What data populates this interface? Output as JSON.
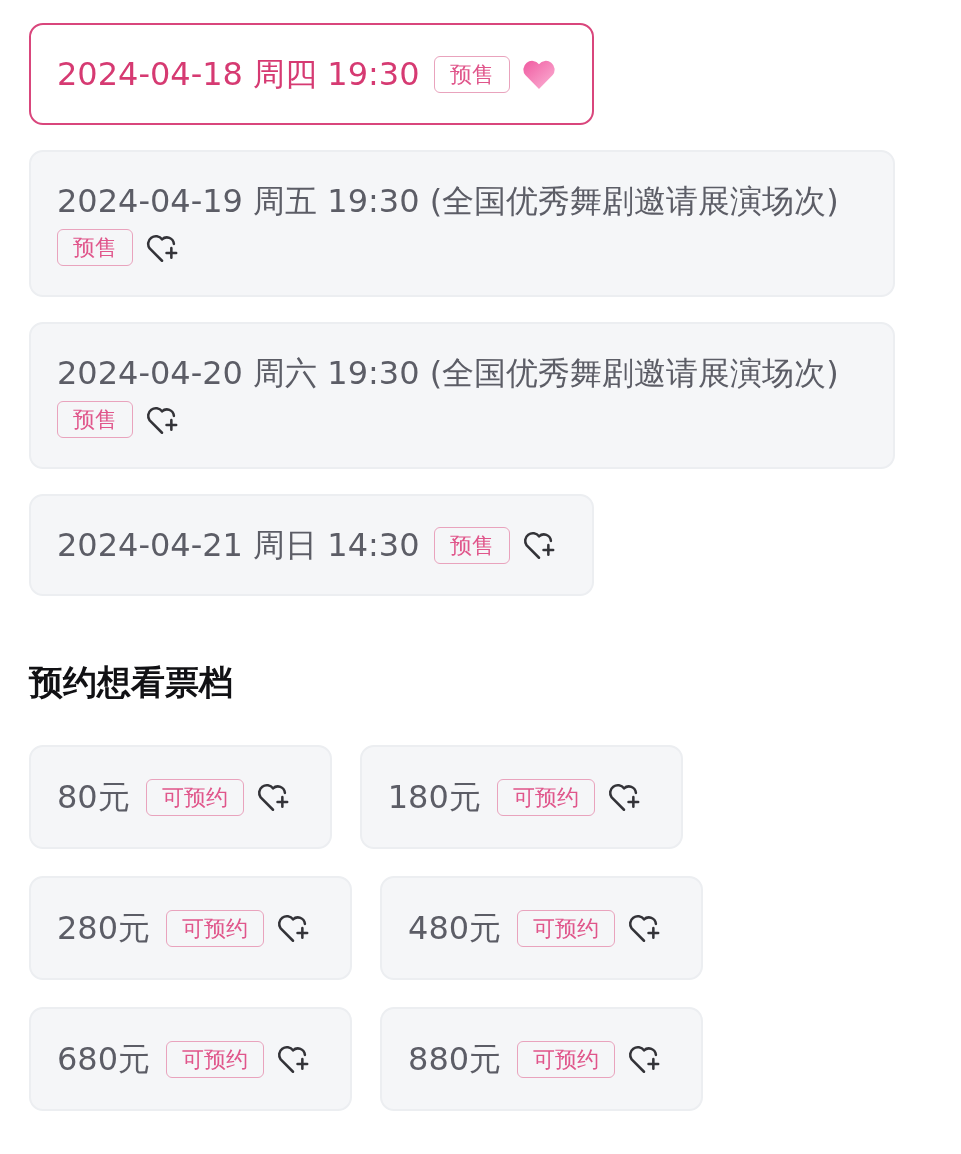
{
  "sessions": [
    {
      "label": "2024-04-18 周四 19:30",
      "badge": "预售",
      "selected": true,
      "wished": true
    },
    {
      "label": "2024-04-19 周五 19:30 (全国优秀舞剧邀请展演场次)",
      "badge": "预售",
      "selected": false,
      "wished": false
    },
    {
      "label": "2024-04-20 周六 19:30 (全国优秀舞剧邀请展演场次)",
      "badge": "预售",
      "selected": false,
      "wished": false
    },
    {
      "label": "2024-04-21 周日 14:30",
      "badge": "预售",
      "selected": false,
      "wished": false
    }
  ],
  "tier_section": {
    "title": "预约想看票档",
    "tiers": [
      {
        "price": "80元",
        "badge": "可预约",
        "wished": false
      },
      {
        "price": "180元",
        "badge": "可预约",
        "wished": false
      },
      {
        "price": "280元",
        "badge": "可预约",
        "wished": false
      },
      {
        "price": "480元",
        "badge": "可预约",
        "wished": false
      },
      {
        "price": "680元",
        "badge": "可预约",
        "wished": false
      },
      {
        "price": "880元",
        "badge": "可预约",
        "wished": false
      }
    ]
  }
}
